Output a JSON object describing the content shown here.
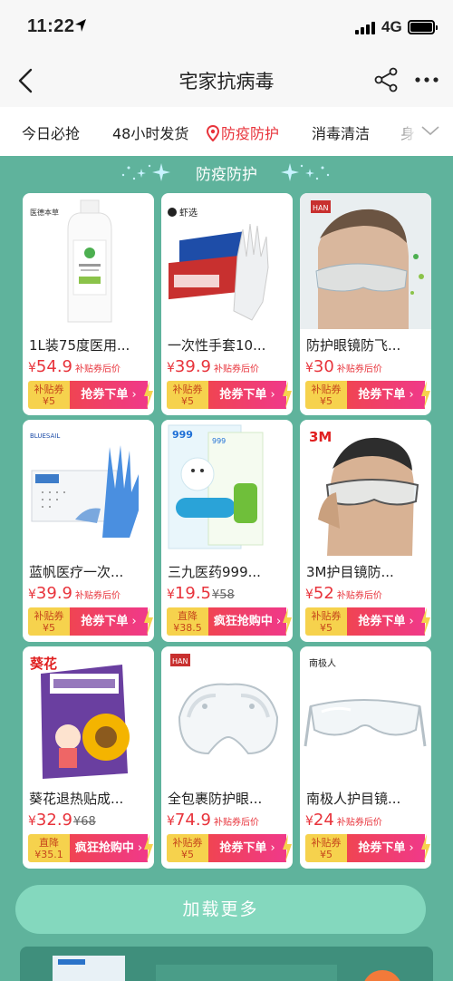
{
  "status": {
    "time": "11:22",
    "network": "4G"
  },
  "nav": {
    "title": "宅家抗病毒"
  },
  "tabs": [
    {
      "label": "今日必抢"
    },
    {
      "label": "48小时发货"
    },
    {
      "label": "防疫防护",
      "active": true
    },
    {
      "label": "消毒清洁"
    },
    {
      "label": "身"
    }
  ],
  "section": {
    "title": "防疫防护"
  },
  "products": [
    {
      "name": "1L装75度医用...",
      "price": "54.9",
      "note": "补贴券后价",
      "coupon_top": "补贴券",
      "coupon_bottom": "¥5",
      "action": "抢券下单",
      "image_icon": "disinfectant-bottle"
    },
    {
      "name": "一次性手套10...",
      "price": "39.9",
      "note": "补贴券后价",
      "coupon_top": "补贴券",
      "coupon_bottom": "¥5",
      "action": "抢券下单",
      "brand": "虾选",
      "image_icon": "disposable-gloves"
    },
    {
      "name": "防护眼镜防飞...",
      "price": "30",
      "note": "补贴券后价",
      "coupon_top": "补贴券",
      "coupon_bottom": "¥5",
      "action": "抢券下单",
      "brand": "HAN",
      "image_icon": "goggles-model"
    },
    {
      "name": "蓝帆医疗一次...",
      "price": "39.9",
      "note": "补贴券后价",
      "coupon_top": "补贴券",
      "coupon_bottom": "¥5",
      "action": "抢券下单",
      "brand": "BLUESAIL",
      "image_icon": "nitrile-gloves"
    },
    {
      "name": "三九医药999...",
      "price": "19.5",
      "old_price": "¥58",
      "coupon_top": "直降",
      "coupon_bottom": "¥38.5",
      "action": "疯狂抢购中",
      "brand": "999",
      "image_icon": "cooling-patch"
    },
    {
      "name": "3M护目镜防...",
      "price": "52",
      "note": "补贴券后价",
      "coupon_top": "补贴券",
      "coupon_bottom": "¥5",
      "action": "抢券下单",
      "brand": "3M",
      "image_icon": "goggles-model"
    },
    {
      "name": "葵花退热贴成...",
      "price": "32.9",
      "old_price": "¥68",
      "coupon_top": "直降",
      "coupon_bottom": "¥35.1",
      "action": "疯狂抢购中",
      "brand": "葵花",
      "image_icon": "fever-patch-box"
    },
    {
      "name": "全包裹防护眼...",
      "price": "74.9",
      "note": "补贴券后价",
      "coupon_top": "补贴券",
      "coupon_bottom": "¥5",
      "action": "抢券下单",
      "brand": "HAN",
      "image_icon": "sealed-goggles"
    },
    {
      "name": "南极人护目镜...",
      "price": "24",
      "note": "补贴券后价",
      "coupon_top": "补贴券",
      "coupon_bottom": "¥5",
      "action": "抢券下单",
      "brand": "南极人",
      "image_icon": "safety-glasses"
    }
  ],
  "load_more": "加载更多",
  "colors": {
    "background": "#5fb39c",
    "accent_red": "#e8333b",
    "coupon_yellow": "#f6d24d",
    "load_more": "#84d8be"
  }
}
